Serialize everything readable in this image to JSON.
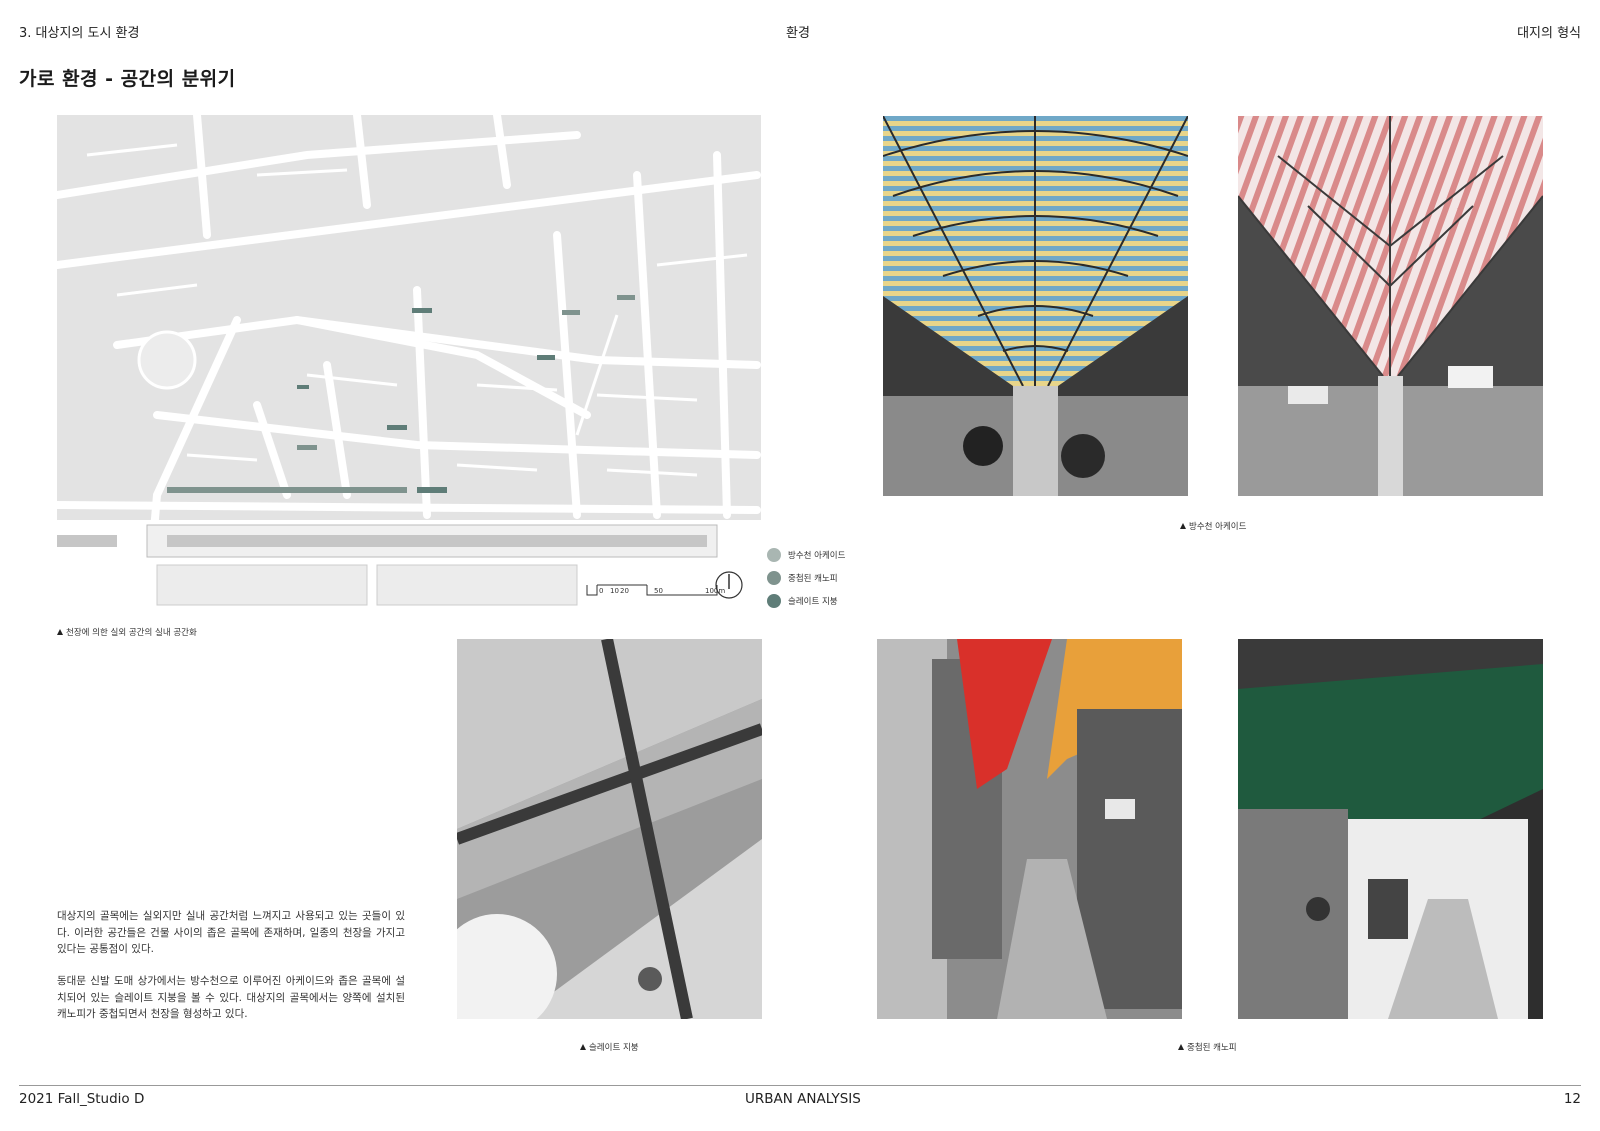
{
  "header": {
    "section": "3. 대상지의 도시 환경",
    "center": "환경",
    "right": "대지의 형식"
  },
  "page_title": "가로 환경 - 공간의 분위기",
  "map": {
    "caption": "천장에 의한 실외 공간의 실내 공간화",
    "scale_labels": [
      "0",
      "10",
      "20",
      "50",
      "100m"
    ],
    "legend": [
      {
        "label": "방수천 아케이드",
        "color": "#a9b6b2"
      },
      {
        "label": "중첩된 캐노피",
        "color": "#7f938e"
      },
      {
        "label": "슬레이트 지붕",
        "color": "#5f7d78"
      }
    ]
  },
  "photos": {
    "arcade_caption": "방수천 아케이드",
    "slate_caption": "슬레이트 지붕",
    "canopy_caption": "중첩된 캐노피"
  },
  "body_text": {
    "paragraph1": "대상지의 골목에는 실외지만 실내 공간처럼 느껴지고 사용되고 있는 곳들이 있다. 이러한 공간들은 건물 사이의 좁은 골목에 존재하며, 일종의 천장을 가지고 있다는 공통점이 있다.",
    "paragraph2": "동대문 신발 도매 상가에서는 방수천으로 이루어진 아케이드와 좁은 골목에 설치되어 있는 슬레이트 지붕을 볼 수 있다. 대상지의 골목에서는 양쪽에 설치된 캐노피가 중첩되면서 천장을 형성하고 있다."
  },
  "footer": {
    "left": "2021 Fall_Studio D",
    "center": "URBAN ANALYSIS",
    "right": "12"
  }
}
